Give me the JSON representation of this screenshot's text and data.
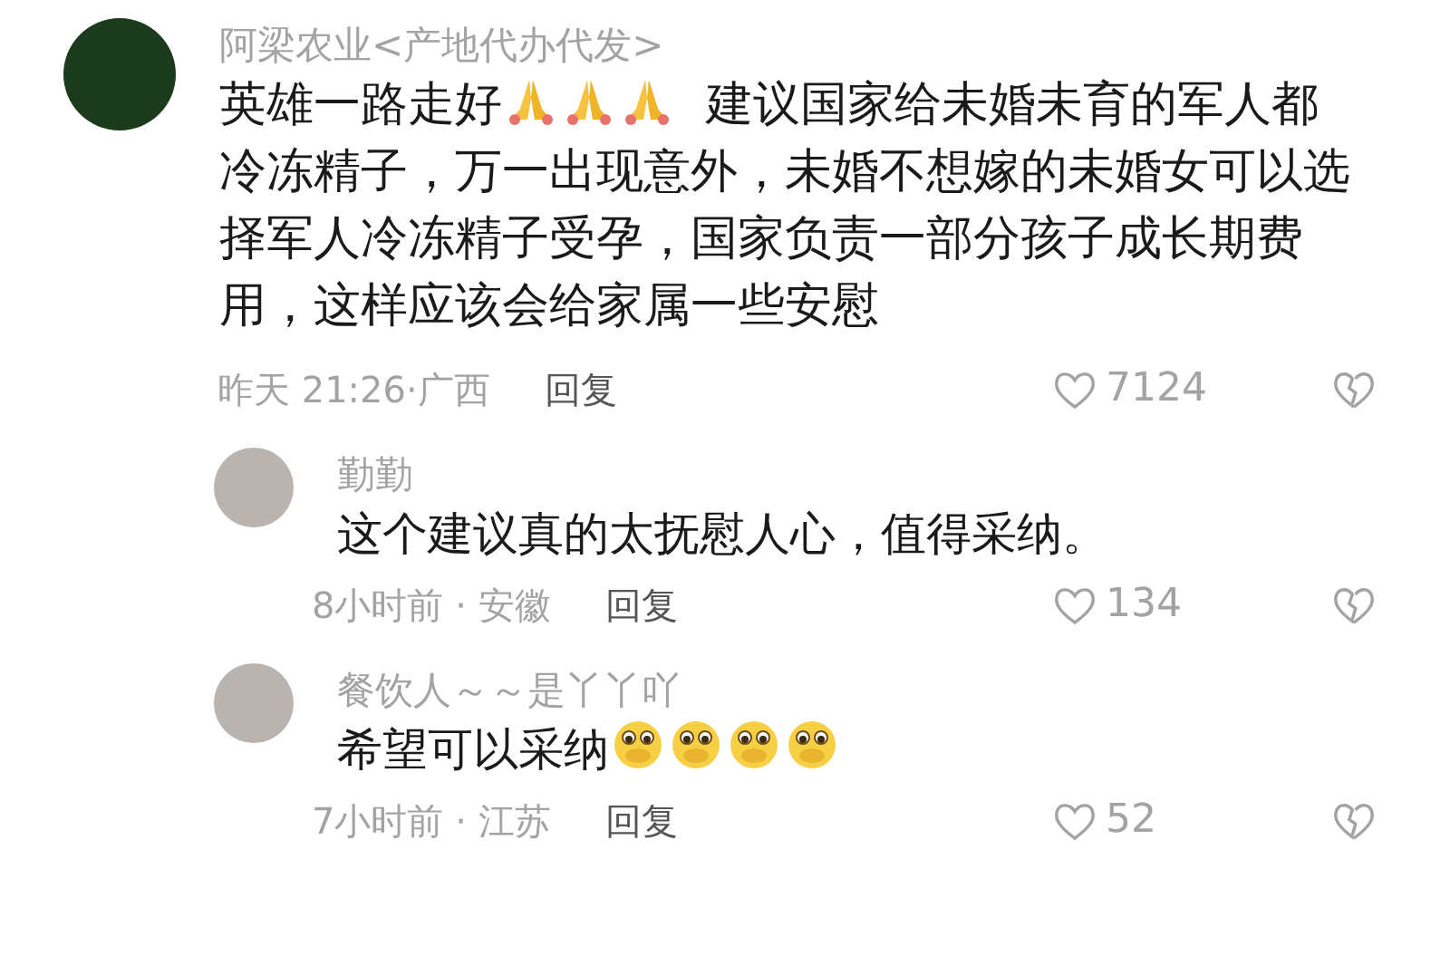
{
  "comment": {
    "author": "阿梁农业<产地代办代发>",
    "content": [
      {
        "kind": "text",
        "text": "英雄一路走好"
      },
      {
        "kind": "pray"
      },
      {
        "kind": "pray"
      },
      {
        "kind": "pray"
      },
      {
        "kind": "text",
        "text": "  建议国家给未婚未育的军人都冷冻精子，万一出现意外，未婚不想嫁的未婚女可以选择军人冷冻精子受孕，国家负责一部分孩子成长期费用，这样应该会给家属一些安慰"
      }
    ],
    "time": "昨天 21:26·广西",
    "reply": "回复",
    "likes": "7124",
    "replies": [
      {
        "author": "勤勤",
        "content": [
          {
            "kind": "text",
            "text": "这个建议真的太抚慰人心，值得采纳。"
          }
        ],
        "time": "8小时前 · 安徽",
        "reply": "回复",
        "likes": "134"
      },
      {
        "author": "餐饮人～～是丫丫吖",
        "content": [
          {
            "kind": "text",
            "text": "希望可以采纳"
          },
          {
            "kind": "pleading"
          },
          {
            "kind": "pleading"
          },
          {
            "kind": "pleading"
          },
          {
            "kind": "pleading"
          }
        ],
        "time": "7小时前 · 江苏",
        "reply": "回复",
        "likes": "52"
      }
    ]
  }
}
